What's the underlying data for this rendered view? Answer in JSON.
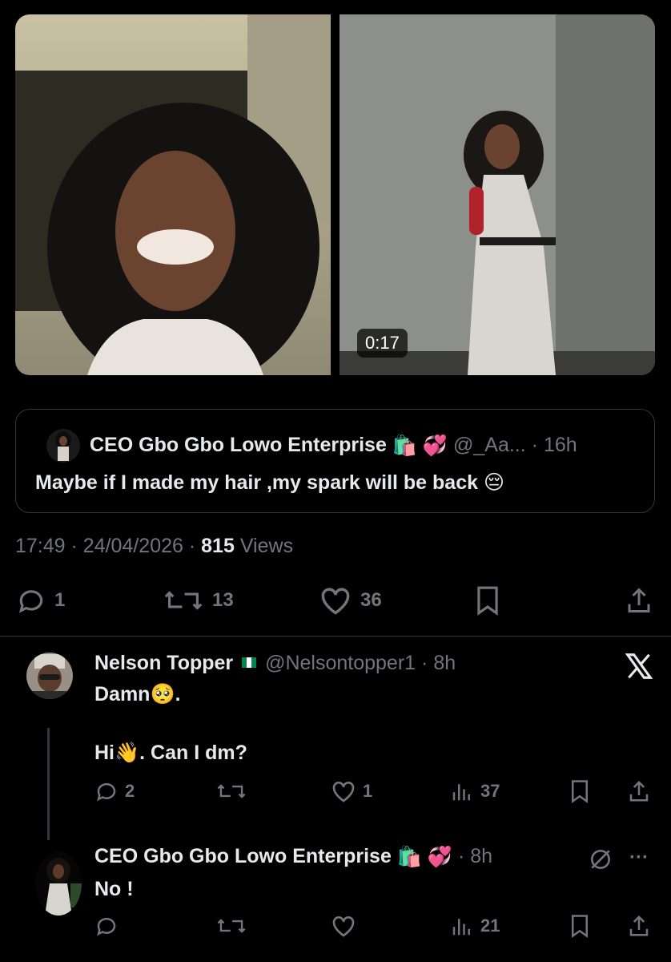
{
  "media": {
    "video_duration": "0:17"
  },
  "quoted_post": {
    "display_name": "CEO Gbo Gbo Lowo Enterprise",
    "handle": "@_Aa...",
    "time": "16h",
    "text": "Maybe if I made my hair ,my spark will be back 😔",
    "emoji_after_name": [
      "🛍️",
      "💞"
    ]
  },
  "post_meta": {
    "time": "17:49",
    "date": "24/04/2026",
    "views_count": "815",
    "views_label": "Views"
  },
  "post_actions": {
    "replies": "1",
    "reposts": "13",
    "likes": "36"
  },
  "replies": [
    {
      "display_name": "Nelson Topper",
      "handle": "@Nelsontopper1",
      "time": "8h",
      "text_line1": "Damn🥺.",
      "text_line2": "Hi👋. Can I dm?",
      "replies": "2",
      "reposts": "",
      "likes": "1",
      "views": "37"
    },
    {
      "display_name": "CEO Gbo Gbo Lowo Enterprise",
      "emoji_after_name": [
        "🛍️",
        "💞"
      ],
      "time": "8h",
      "text": "No !",
      "views": "21"
    }
  ],
  "colors": {
    "background": "#000000",
    "text": "#e7e9ea",
    "muted": "#71767b",
    "border": "#2f3336"
  },
  "icons": [
    "reply-icon",
    "repost-icon",
    "like-icon",
    "bookmark-icon",
    "share-icon",
    "views-icon",
    "x-logo-icon",
    "more-icon",
    "hidden-reply-icon"
  ]
}
